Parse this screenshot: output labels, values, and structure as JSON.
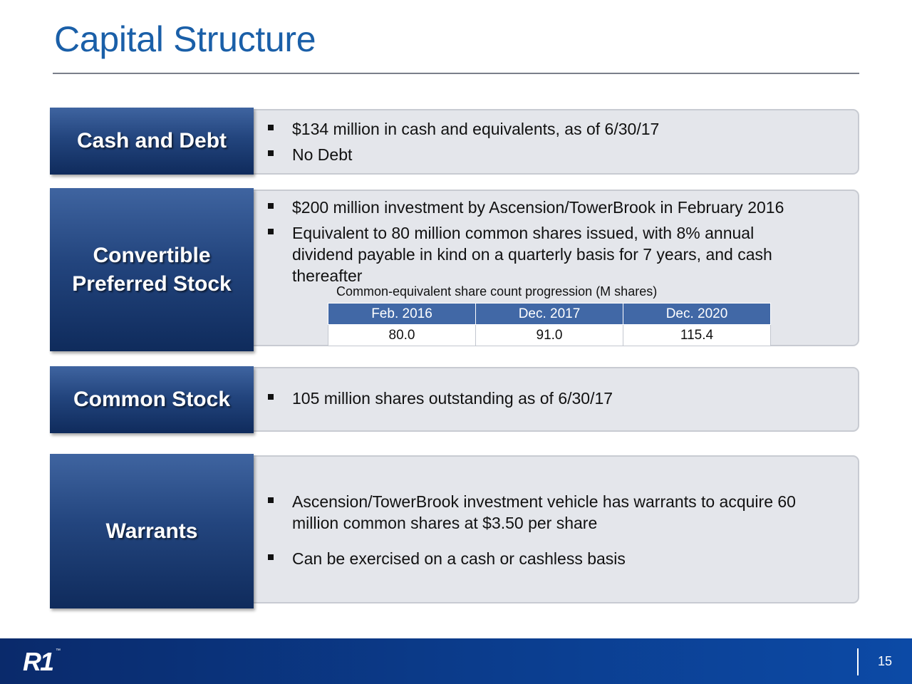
{
  "title": "Capital Structure",
  "sections": {
    "cash_debt": {
      "label": "Cash and Debt",
      "bullets": [
        "$134 million in cash and equivalents, as of 6/30/17",
        "No Debt"
      ]
    },
    "convertible": {
      "label_line1": "Convertible",
      "label_line2": "Preferred Stock",
      "bullet1": "$200 million investment by Ascension/TowerBrook in February 2016",
      "bullet2_lines": [
        "Equivalent to 80 million common shares issued, with 8% annual",
        "dividend payable in kind on a quarterly basis for 7 years, and cash",
        "thereafter"
      ],
      "table_caption": "Common-equivalent share count progression (M shares)",
      "table_headers": [
        "Feb. 2016",
        "Dec. 2017",
        "Dec. 2020"
      ],
      "table_values": [
        "80.0",
        "91.0",
        "115.4"
      ]
    },
    "common_stock": {
      "label": "Common Stock",
      "bullets": [
        "105 million shares outstanding as of 6/30/17"
      ]
    },
    "warrants": {
      "label": "Warrants",
      "bullet1_lines": [
        "Ascension/TowerBrook investment vehicle has warrants to acquire 60",
        "million common shares at $3.50 per share"
      ],
      "bullet2": "Can be exercised on a cash or cashless basis"
    }
  },
  "footer": {
    "logo": "R1",
    "logo_tm": "™",
    "page_number": "15"
  },
  "colors": {
    "title_blue": "#1a5fa8",
    "label_box_navy": "#23457e",
    "panel_gray": "#e4e6eb",
    "table_header_blue": "#4168a6",
    "footer_blue": "#0b3d8e"
  }
}
